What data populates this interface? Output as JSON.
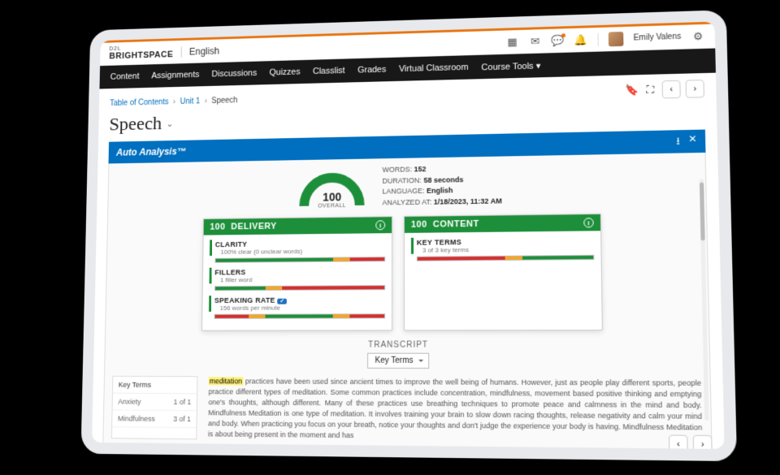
{
  "brand": {
    "d2l": "D2L",
    "name": "BRIGHTSPACE"
  },
  "course": "English",
  "user": {
    "name": "Emily Valens"
  },
  "nav": [
    "Content",
    "Assignments",
    "Discussions",
    "Quizzes",
    "Classlist",
    "Grades",
    "Virtual Classroom",
    "Course Tools ▾"
  ],
  "breadcrumbs": {
    "a": "Table of Contents",
    "b": "Unit 1",
    "c": "Speech"
  },
  "page_title": "Speech",
  "analysis_header": "Auto Analysis™",
  "gauge": {
    "score": "100",
    "overall": "OVERALL"
  },
  "meta": {
    "words_label": "WORDS:",
    "words": "152",
    "duration_label": "DURATION:",
    "duration": "58 seconds",
    "language_label": "LANGUAGE:",
    "language": "English",
    "analyzed_label": "ANALYZED AT:",
    "analyzed": "1/18/2023, 11:32 AM"
  },
  "cards": {
    "delivery": {
      "score": "100",
      "title": "DELIVERY",
      "metrics": [
        {
          "title": "CLARITY",
          "sub": "100% clear (0 unclear words)"
        },
        {
          "title": "FILLERS",
          "sub": "1 filler word"
        },
        {
          "title": "SPEAKING RATE",
          "sub": "156 words per minute",
          "badge": "✓"
        }
      ]
    },
    "content": {
      "score": "100",
      "title": "CONTENT",
      "metrics": [
        {
          "title": "KEY TERMS",
          "sub": "3 of 3 key terms"
        }
      ]
    }
  },
  "transcript": {
    "heading": "TRANSCRIPT",
    "select": "Key Terms",
    "key_terms_label": "Key Terms",
    "terms": [
      {
        "name": "Anxiety",
        "count": "1 of 1"
      },
      {
        "name": "Mindfulness",
        "count": "3 of 1"
      }
    ],
    "para_parts": [
      "meditation",
      " practices have been used since ancient times to improve the well being of humans. However, just as people play different sports, people practice different types of ",
      "meditation",
      ". Some common practices include concentration, ",
      "mindfulness",
      ", movement based positive thinking and emptying one's thoughts, although different. Many of these practices use breathing techniques to promote peace and calmness in the mind and body. ",
      "Mindfulness",
      "  ",
      "Meditation",
      " is one type of ",
      "meditation",
      ". It involves training your brain to slow down racing thoughts, release negativity and calm your mind and body. When practicing you focus on your breath, notice your thoughts and don't judge the experience your body is having. ",
      "Mindfulness",
      "  ",
      "Meditation",
      " is about being present in the moment and has"
    ]
  }
}
